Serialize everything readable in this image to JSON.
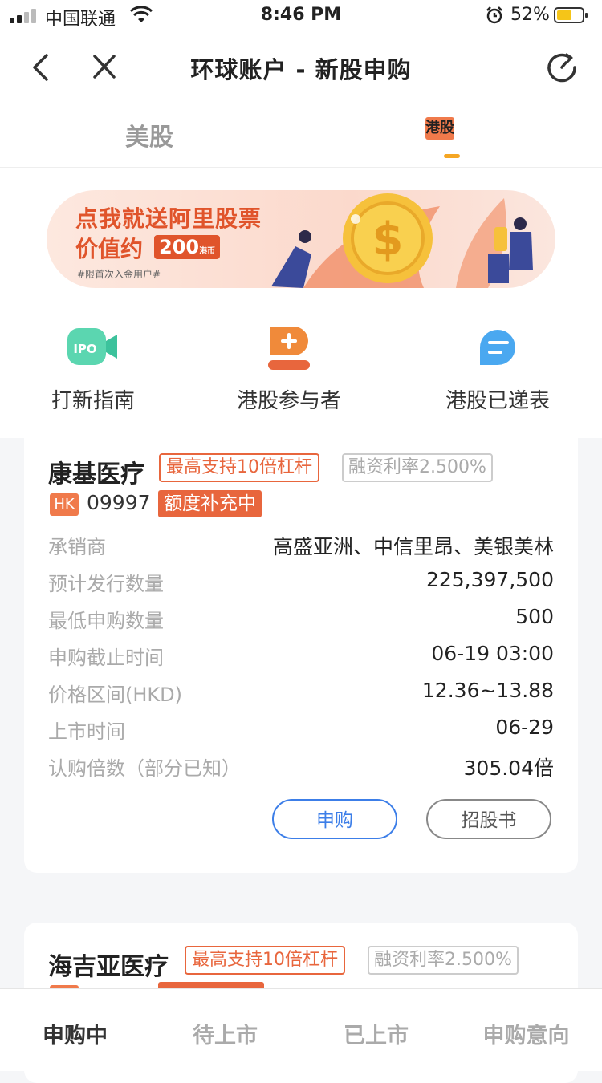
{
  "status": {
    "carrier": "中国联通",
    "time": "8:46 PM",
    "battery": "52%",
    "battery_level": 0.52
  },
  "nav": {
    "title": "环球账户 - 新股申购"
  },
  "market_tabs": [
    {
      "label": "美股"
    },
    {
      "label": "港股"
    }
  ],
  "banner": {
    "line1": "点我就送阿里股票",
    "line2": "价值约",
    "amount": "200",
    "unit": "港币",
    "note": "#限首次入金用户#"
  },
  "quick_links": [
    {
      "label": "打新指南",
      "icon": "ipo-video-icon"
    },
    {
      "label": "港股参与者",
      "icon": "person-plus-icon"
    },
    {
      "label": "港股已递表",
      "icon": "list-bubble-icon"
    }
  ],
  "ipo_cards": [
    {
      "name": "康基医疗",
      "leverage_tag": "最高支持10倍杠杆",
      "rate_tag": "融资利率2.500%",
      "market": "HK",
      "code": "09997",
      "status_tag": "额度补充中",
      "rows": [
        {
          "label": "承销商",
          "value": "高盛亚洲、中信里昂、美银美林"
        },
        {
          "label": "预计发行数量",
          "value": "225,397,500"
        },
        {
          "label": "最低申购数量",
          "value": "500"
        },
        {
          "label": "申购截止时间",
          "value": "06-19 03:00"
        },
        {
          "label": "价格区间(HKD)",
          "value": "12.36~13.88"
        },
        {
          "label": "上市时间",
          "value": "06-29"
        },
        {
          "label": "认购倍数（部分已知）",
          "value": "305.04倍"
        }
      ],
      "apply_label": "申购",
      "prospectus_label": "招股书"
    },
    {
      "name": "海吉亚医疗",
      "leverage_tag": "最高支持10倍杠杆",
      "rate_tag": "融资利率2.500%"
    }
  ],
  "bottom_tabs": [
    {
      "label": "申购中"
    },
    {
      "label": "待上市"
    },
    {
      "label": "已上市"
    },
    {
      "label": "申购意向"
    }
  ],
  "colors": {
    "accent_orange": "#e8663d",
    "tab_underline": "#f5a623",
    "apply_blue": "#3c7ee8"
  }
}
